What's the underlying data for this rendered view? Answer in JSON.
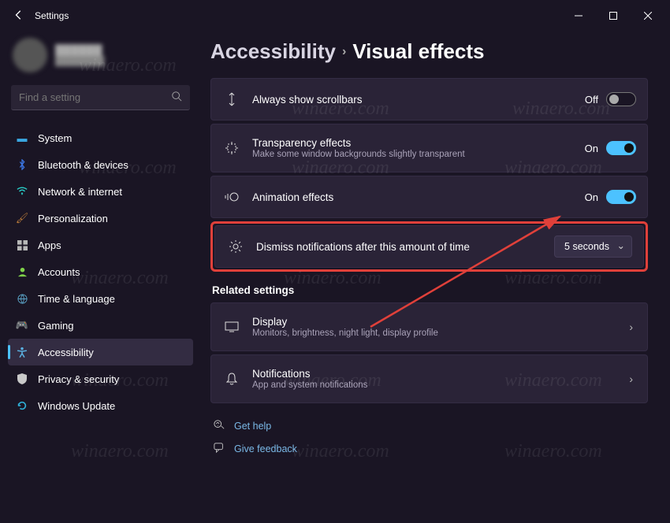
{
  "window": {
    "title": "Settings"
  },
  "search": {
    "placeholder": "Find a setting"
  },
  "nav": {
    "items": [
      {
        "label": "System",
        "color": "#3aa6e0"
      },
      {
        "label": "Bluetooth & devices",
        "color": "#3a74e0"
      },
      {
        "label": "Network & internet",
        "color": "#29d0c9"
      },
      {
        "label": "Personalization",
        "color": "#b97a3a"
      },
      {
        "label": "Apps",
        "color": "#b8b8b8"
      },
      {
        "label": "Accounts",
        "color": "#7fd14a"
      },
      {
        "label": "Time & language",
        "color": "#5aa2c6"
      },
      {
        "label": "Gaming",
        "color": "#d14a92"
      },
      {
        "label": "Accessibility",
        "color": "#5ab0e0"
      },
      {
        "label": "Privacy & security",
        "color": "#c9c9c9"
      },
      {
        "label": "Windows Update",
        "color": "#2fb2da"
      }
    ],
    "active_index": 8
  },
  "breadcrumb": {
    "parent": "Accessibility",
    "current": "Visual effects"
  },
  "settings": {
    "scrollbars": {
      "label": "Always show scrollbars",
      "state_label": "Off",
      "on": false
    },
    "transparency": {
      "label": "Transparency effects",
      "sub": "Make some window backgrounds slightly transparent",
      "state_label": "On",
      "on": true
    },
    "animation": {
      "label": "Animation effects",
      "state_label": "On",
      "on": true
    },
    "dismiss": {
      "label": "Dismiss notifications after this amount of time",
      "value": "5 seconds"
    }
  },
  "related": {
    "heading": "Related settings",
    "display": {
      "label": "Display",
      "sub": "Monitors, brightness, night light, display profile"
    },
    "notifications": {
      "label": "Notifications",
      "sub": "App and system notifications"
    }
  },
  "help": {
    "get_help": "Get help",
    "feedback": "Give feedback"
  },
  "watermark_text": "winaero.com"
}
